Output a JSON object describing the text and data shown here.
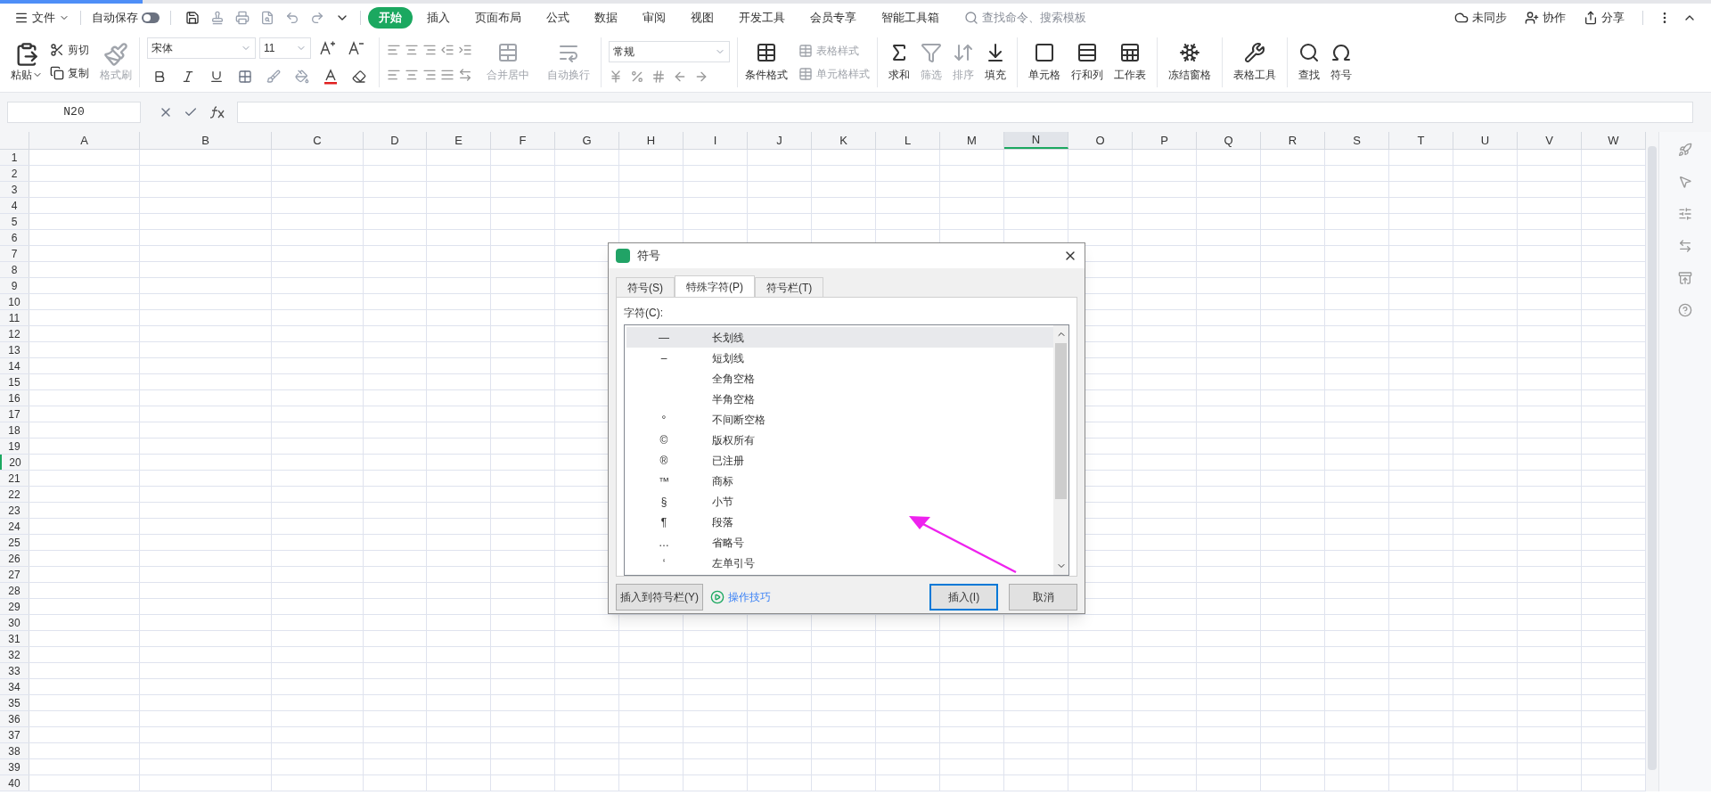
{
  "top_bar": {
    "file_menu": "文件",
    "autosave": {
      "label": "自动保存",
      "on": false
    },
    "tabs": [
      {
        "label": "开始",
        "selected": true
      },
      {
        "label": "插入",
        "selected": false
      },
      {
        "label": "页面布局",
        "selected": false
      },
      {
        "label": "公式",
        "selected": false
      },
      {
        "label": "数据",
        "selected": false
      },
      {
        "label": "审阅",
        "selected": false
      },
      {
        "label": "视图",
        "selected": false
      },
      {
        "label": "开发工具",
        "selected": false
      },
      {
        "label": "会员专享",
        "selected": false
      },
      {
        "label": "智能工具箱",
        "selected": false
      }
    ],
    "search": {
      "placeholder": "查找命令、搜索模板"
    },
    "actions": [
      {
        "label": "未同步",
        "kind": "cloud"
      },
      {
        "label": "协作",
        "kind": "user"
      },
      {
        "label": "分享",
        "kind": "share"
      }
    ]
  },
  "ribbon": {
    "clipboard": {
      "paste": "粘贴",
      "cut": "剪切",
      "copy": "复制",
      "format_painter": {
        "label": "格式刷",
        "disabled": true
      }
    },
    "font": {
      "name": "宋体",
      "size": "11"
    },
    "alignment": {
      "merge": {
        "label": "合并居中",
        "disabled": true
      },
      "wrap": {
        "label": "自动换行",
        "disabled": true
      }
    },
    "number": {
      "format": "常规"
    },
    "conditional_format": {
      "label": "条件格式",
      "disabled": false
    },
    "style_links": [
      {
        "label": "表格样式",
        "disabled": true
      },
      {
        "label": "单元格样式",
        "disabled": true
      }
    ],
    "tool_groups": [
      {
        "items": [
          {
            "label": "求和",
            "kind": "sum",
            "disabled": false
          },
          {
            "label": "筛选",
            "kind": "filter",
            "disabled": true
          },
          {
            "label": "排序",
            "kind": "sort",
            "disabled": true
          },
          {
            "label": "填充",
            "kind": "fill",
            "disabled": false
          }
        ]
      },
      {
        "items": [
          {
            "label": "单元格",
            "kind": "cell",
            "disabled": false
          },
          {
            "label": "行和列",
            "kind": "rows",
            "disabled": false
          },
          {
            "label": "工作表",
            "kind": "sheet",
            "disabled": false
          }
        ]
      },
      {
        "items": [
          {
            "label": "冻结窗格",
            "kind": "freeze",
            "disabled": false
          }
        ]
      },
      {
        "items": [
          {
            "label": "表格工具",
            "kind": "tools",
            "disabled": false
          }
        ]
      },
      {
        "items": [
          {
            "label": "查找",
            "kind": "find",
            "disabled": false
          },
          {
            "label": "符号",
            "kind": "symbol",
            "disabled": false
          }
        ]
      }
    ]
  },
  "formula_bar": {
    "cell_reference": "N20"
  },
  "sheet": {
    "columns": [
      {
        "label": "A",
        "selected": false
      },
      {
        "label": "B",
        "selected": false
      },
      {
        "label": "C",
        "selected": false
      },
      {
        "label": "D",
        "selected": false
      },
      {
        "label": "E",
        "selected": false
      },
      {
        "label": "F",
        "selected": false
      },
      {
        "label": "G",
        "selected": false
      },
      {
        "label": "H",
        "selected": false
      },
      {
        "label": "I",
        "selected": false
      },
      {
        "label": "J",
        "selected": false
      },
      {
        "label": "K",
        "selected": false
      },
      {
        "label": "L",
        "selected": false
      },
      {
        "label": "M",
        "selected": false
      },
      {
        "label": "N",
        "selected": true
      },
      {
        "label": "O",
        "selected": false
      },
      {
        "label": "P",
        "selected": false
      },
      {
        "label": "Q",
        "selected": false
      },
      {
        "label": "R",
        "selected": false
      },
      {
        "label": "S",
        "selected": false
      },
      {
        "label": "T",
        "selected": false
      },
      {
        "label": "U",
        "selected": false
      },
      {
        "label": "V",
        "selected": false
      },
      {
        "label": "W",
        "selected": false
      }
    ],
    "rows": [
      {
        "label": "1",
        "selected": false
      },
      {
        "label": "2",
        "selected": false
      },
      {
        "label": "3",
        "selected": false
      },
      {
        "label": "4",
        "selected": false
      },
      {
        "label": "5",
        "selected": false
      },
      {
        "label": "6",
        "selected": false
      },
      {
        "label": "7",
        "selected": false
      },
      {
        "label": "8",
        "selected": false
      },
      {
        "label": "9",
        "selected": false
      },
      {
        "label": "10",
        "selected": false
      },
      {
        "label": "11",
        "selected": false
      },
      {
        "label": "12",
        "selected": false
      },
      {
        "label": "13",
        "selected": false
      },
      {
        "label": "14",
        "selected": false
      },
      {
        "label": "15",
        "selected": false
      },
      {
        "label": "16",
        "selected": false
      },
      {
        "label": "17",
        "selected": false
      },
      {
        "label": "18",
        "selected": false
      },
      {
        "label": "19",
        "selected": false
      },
      {
        "label": "20",
        "selected": true
      },
      {
        "label": "21",
        "selected": false
      },
      {
        "label": "22",
        "selected": false
      },
      {
        "label": "23",
        "selected": false
      },
      {
        "label": "24",
        "selected": false
      },
      {
        "label": "25",
        "selected": false
      },
      {
        "label": "26",
        "selected": false
      },
      {
        "label": "27",
        "selected": false
      },
      {
        "label": "28",
        "selected": false
      },
      {
        "label": "29",
        "selected": false
      },
      {
        "label": "30",
        "selected": false
      },
      {
        "label": "31",
        "selected": false
      },
      {
        "label": "32",
        "selected": false
      },
      {
        "label": "33",
        "selected": false
      },
      {
        "label": "34",
        "selected": false
      },
      {
        "label": "35",
        "selected": false
      },
      {
        "label": "36",
        "selected": false
      },
      {
        "label": "37",
        "selected": false
      },
      {
        "label": "38",
        "selected": false
      },
      {
        "label": "39",
        "selected": false
      },
      {
        "label": "40",
        "selected": false
      }
    ]
  },
  "dialog": {
    "title": "符号",
    "tabs": [
      {
        "label": "符号(S)",
        "selected": false
      },
      {
        "label": "特殊字符(P)",
        "selected": true
      },
      {
        "label": "符号栏(T)",
        "selected": false
      }
    ],
    "list_label": "字符(C):",
    "items": [
      {
        "symbol": "—",
        "name": "长划线",
        "selected": true
      },
      {
        "symbol": "–",
        "name": "短划线",
        "selected": false
      },
      {
        "name": "全角空格",
        "selected": false
      },
      {
        "name": "半角空格",
        "selected": false
      },
      {
        "symbol": "°",
        "name": "不间断空格",
        "selected": false
      },
      {
        "symbol": "©",
        "name": "版权所有",
        "selected": false
      },
      {
        "symbol": "®",
        "name": "已注册",
        "selected": false
      },
      {
        "symbol": "™",
        "name": "商标",
        "selected": false
      },
      {
        "symbol": "§",
        "name": "小节",
        "selected": false
      },
      {
        "symbol": "¶",
        "name": "段落",
        "selected": false
      },
      {
        "symbol": "…",
        "name": "省略号",
        "selected": false
      },
      {
        "symbol": "‘",
        "name": "左单引号",
        "selected": false
      }
    ],
    "add_to_bar_button": "插入到符号栏(Y)",
    "tips_link": "操作技巧",
    "insert_button": "插入(I)",
    "cancel_button": "取消"
  }
}
